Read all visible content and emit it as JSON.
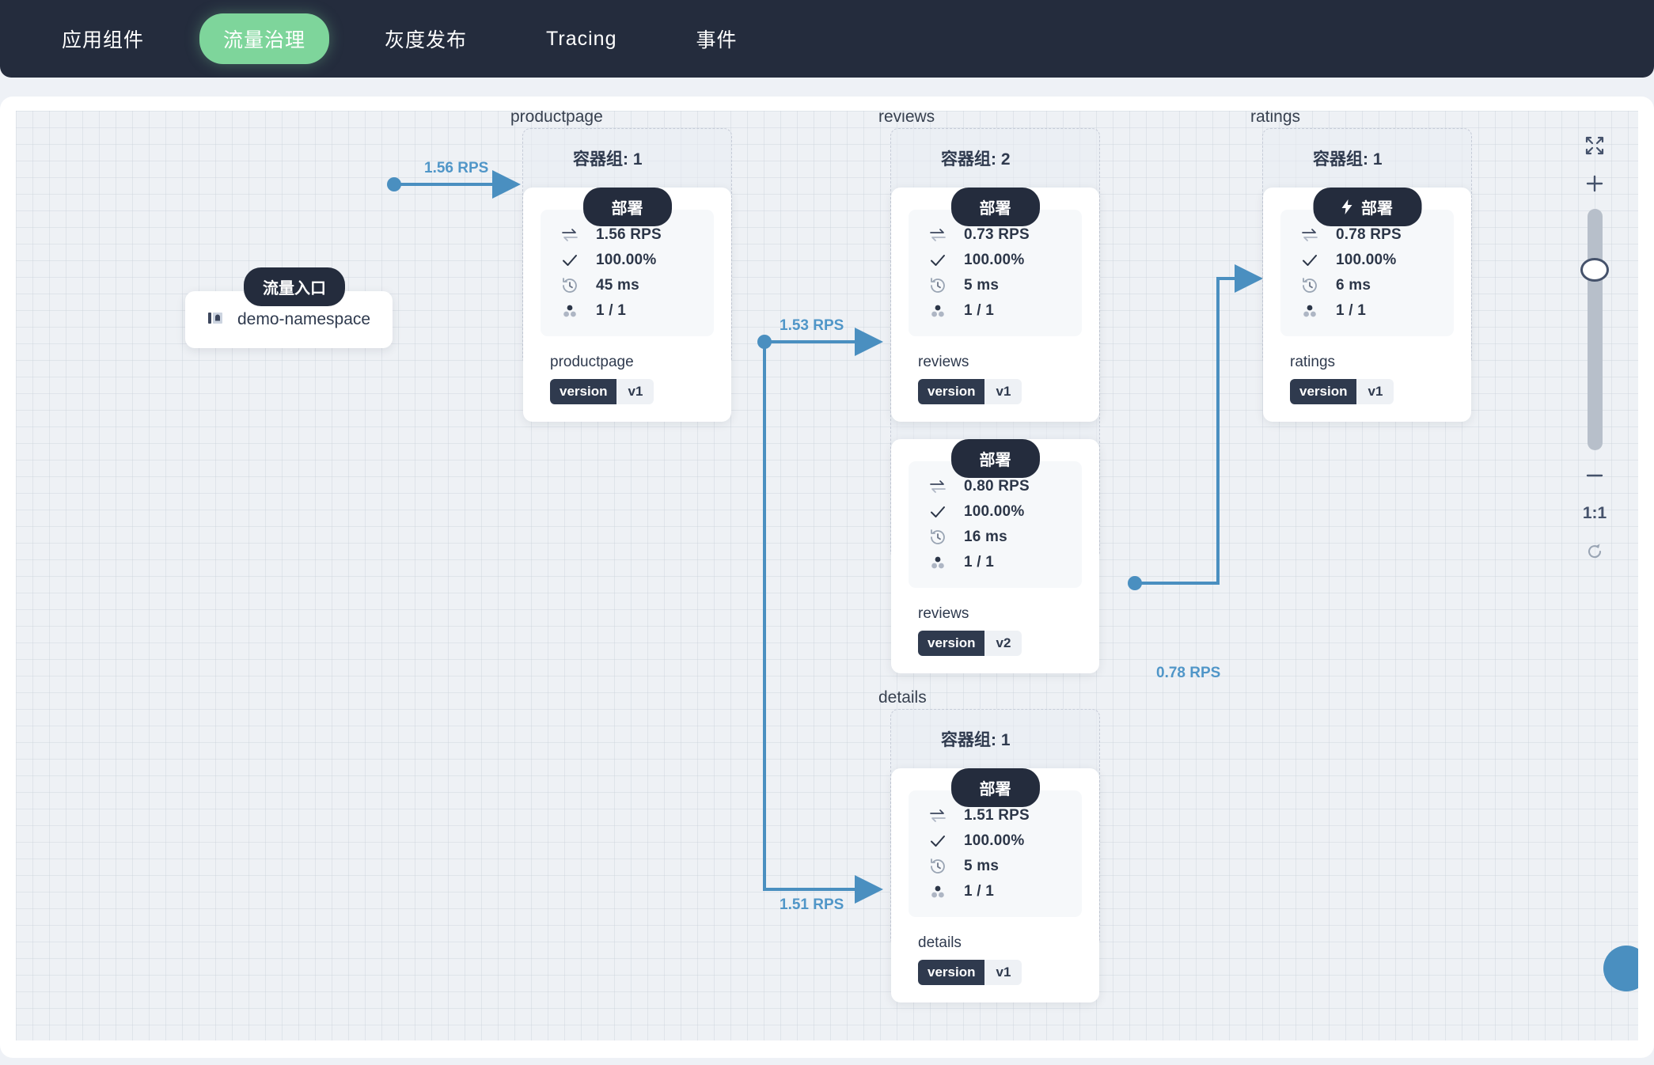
{
  "nav": {
    "items": [
      {
        "label": "应用组件",
        "active": false
      },
      {
        "label": "流量治理",
        "active": true
      },
      {
        "label": "灰度发布",
        "active": false
      },
      {
        "label": "Tracing",
        "active": false
      },
      {
        "label": "事件",
        "active": false
      }
    ]
  },
  "colors": {
    "nav_bg": "#242c3d",
    "nav_active": "#7ed59b",
    "edge": "#4a8fc0",
    "edge_label": "#5096c8",
    "badge_dark": "#242c3d",
    "canvas_bg": "#eef1f5"
  },
  "graph": {
    "entry": {
      "badge": "流量入口",
      "name": "demo-namespace",
      "icon": "namespace-icon"
    },
    "services": [
      {
        "id": "productpage",
        "title": "productpage",
        "pods_label": "容器组: 1",
        "workloads": [
          {
            "badge": "部署",
            "has_bolt": false,
            "rps": "1.56 RPS",
            "success_rate": "100.00%",
            "latency": "45 ms",
            "pods": "1 / 1",
            "name": "productpage",
            "version_key": "version",
            "version_val": "v1"
          }
        ]
      },
      {
        "id": "reviews",
        "title": "reviews",
        "pods_label": "容器组: 2",
        "workloads": [
          {
            "badge": "部署",
            "has_bolt": false,
            "rps": "0.73 RPS",
            "success_rate": "100.00%",
            "latency": "5 ms",
            "pods": "1 / 1",
            "name": "reviews",
            "version_key": "version",
            "version_val": "v1"
          },
          {
            "badge": "部署",
            "has_bolt": false,
            "rps": "0.80 RPS",
            "success_rate": "100.00%",
            "latency": "16 ms",
            "pods": "1 / 1",
            "name": "reviews",
            "version_key": "version",
            "version_val": "v2"
          }
        ]
      },
      {
        "id": "ratings",
        "title": "ratings",
        "pods_label": "容器组: 1",
        "workloads": [
          {
            "badge": "部署",
            "has_bolt": true,
            "rps": "0.78 RPS",
            "success_rate": "100.00%",
            "latency": "6 ms",
            "pods": "1 / 1",
            "name": "ratings",
            "version_key": "version",
            "version_val": "v1"
          }
        ]
      },
      {
        "id": "details",
        "title": "details",
        "pods_label": "容器组: 1",
        "workloads": [
          {
            "badge": "部署",
            "has_bolt": false,
            "rps": "1.51 RPS",
            "success_rate": "100.00%",
            "latency": "5 ms",
            "pods": "1 / 1",
            "name": "details",
            "version_key": "version",
            "version_val": "v1"
          }
        ]
      }
    ],
    "edges": [
      {
        "id": "entry-productpage",
        "label": "1.56 RPS",
        "from": "demo-namespace",
        "to": "productpage"
      },
      {
        "id": "productpage-reviews",
        "label": "1.53 RPS",
        "from": "productpage",
        "to": "reviews"
      },
      {
        "id": "productpage-details",
        "label": "1.51 RPS",
        "from": "productpage",
        "to": "details"
      },
      {
        "id": "reviews-ratings",
        "label": "0.78 RPS",
        "from": "reviews",
        "to": "ratings"
      }
    ]
  },
  "toolbar": {
    "fit_label": "fit-screen-icon",
    "zoom_in_label": "plus-icon",
    "zoom_out_label": "minus-icon",
    "ratio_label": "1:1",
    "reset_label": "reset-icon"
  }
}
